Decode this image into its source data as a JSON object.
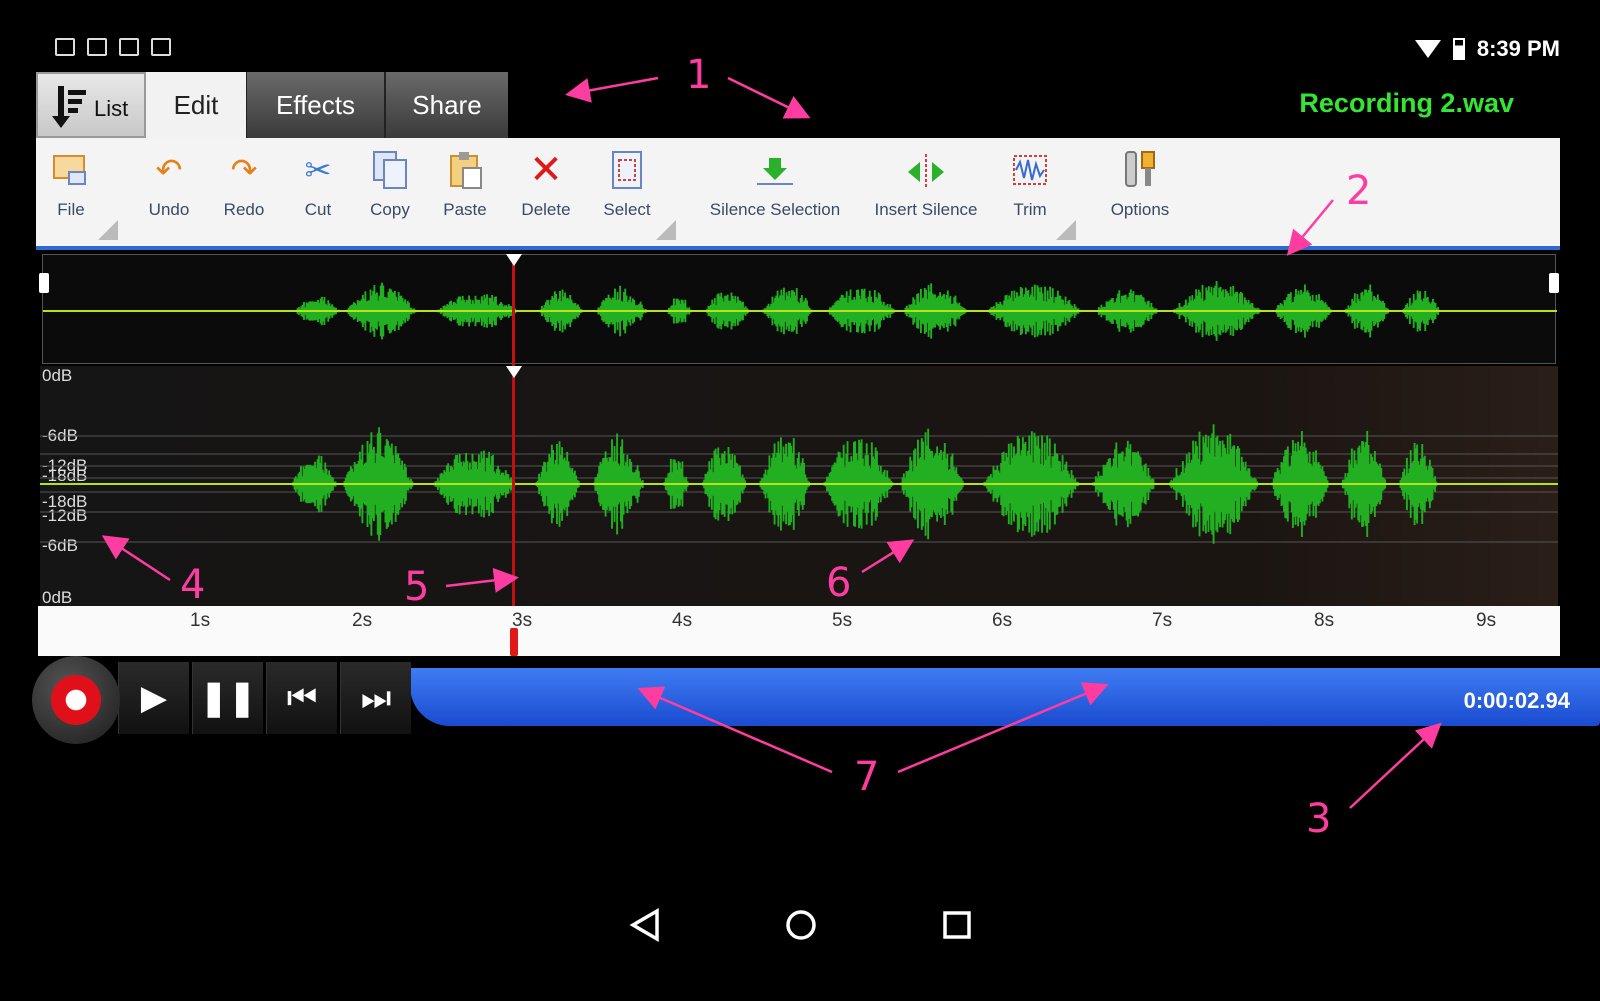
{
  "status_bar": {
    "time": "8:39 PM",
    "left_icons": [
      "download-icon",
      "mail-icon",
      "video-icon",
      "clipboard-icon"
    ],
    "right_icons": [
      "wifi-icon",
      "battery-icon"
    ]
  },
  "tabs": [
    {
      "label": "List",
      "icon": "list-sort-icon"
    },
    {
      "label": "Edit"
    },
    {
      "label": "Effects"
    },
    {
      "label": "Share"
    }
  ],
  "file_name": "Recording 2.wav",
  "toolbar": {
    "file": "File",
    "undo": "Undo",
    "redo": "Redo",
    "cut": "Cut",
    "copy": "Copy",
    "paste": "Paste",
    "delete": "Delete",
    "select": "Select",
    "silence_selection": "Silence Selection",
    "insert_silence": "Insert Silence",
    "trim": "Trim",
    "options": "Options"
  },
  "db_labels": [
    "0dB",
    "-6dB",
    "-12dB",
    "-18dB",
    "-18dB",
    "-12dB",
    "-6dB",
    "0dB"
  ],
  "ruler_ticks": [
    "1s",
    "2s",
    "3s",
    "4s",
    "5s",
    "6s",
    "7s",
    "8s",
    "9s"
  ],
  "transport": {
    "time": "0:00:02.94",
    "buttons": [
      "record-icon",
      "play-icon",
      "pause-icon",
      "skip-back-icon",
      "skip-forward-icon"
    ]
  },
  "annotations": [
    "1",
    "2",
    "3",
    "4",
    "5",
    "6",
    "7"
  ],
  "colors": {
    "waveform": "#22b022",
    "playhead": "#c01010",
    "filename": "#33e633",
    "annotation": "#ff3da0",
    "accent_blue": "#2a6bd6"
  },
  "nav_icons": [
    "back-icon",
    "home-icon",
    "recents-icon"
  ]
}
